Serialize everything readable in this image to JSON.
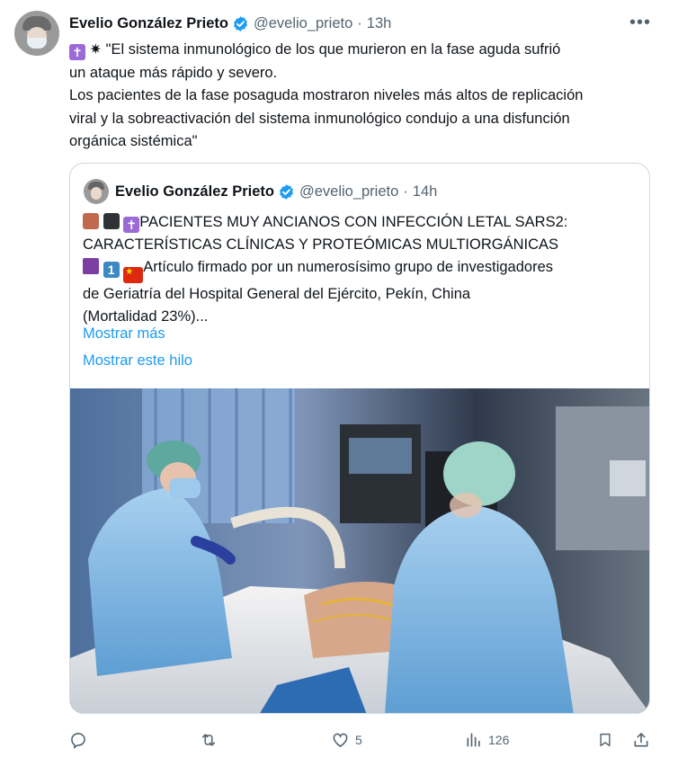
{
  "tweet": {
    "author": {
      "name": "Evelio González Prieto",
      "handle": "@evelio_prieto",
      "time": "13h"
    },
    "dot": "·",
    "more_label": "•••",
    "text_lines": [
      "\"El sistema inmunológico de los que murieron en la fase aguda sufrió",
      "un ataque más rápido y severo.",
      "Los pacientes de la fase posaguda mostraron niveles más altos de replicación",
      "viral  y la sobreactivación del sistema inmunológico condujo a una disfunción",
      "orgánica sistémica\""
    ],
    "stats": {
      "replies": "",
      "retweets": "",
      "likes": "5",
      "views": "126"
    }
  },
  "quote": {
    "author": {
      "name": "Evelio González Prieto",
      "handle": "@evelio_prieto",
      "time": "14h"
    },
    "text_lines": [
      "PACIENTES MUY ANCIANOS CON INFECCIÓN LETAL SARS2:",
      "CARACTERÍSTICAS CLÍNICAS Y PROTEÓMICAS MULTIORGÁNICAS",
      "Artículo firmado por un numerosísimo grupo de investigadores",
      "de Geriatría del Hospital General del Ejército, Pekín, China",
      "(Mortalidad 23%)..."
    ],
    "show_more": "Mostrar más",
    "show_thread": "Mostrar este hilo",
    "emoji_one": "1"
  },
  "colors": {
    "accent": "#1d9bf0",
    "muted": "#536471",
    "border": "#cfd9de"
  },
  "icons": [
    "verified-badge-icon",
    "cross-emoji-icon",
    "sparkle-emoji-icon",
    "brown-square-icon",
    "black-square-icon",
    "thread-spool-icon",
    "keycap-one-icon",
    "china-flag-icon",
    "reply-icon",
    "retweet-icon",
    "like-icon",
    "views-icon",
    "bookmark-icon",
    "share-icon"
  ]
}
